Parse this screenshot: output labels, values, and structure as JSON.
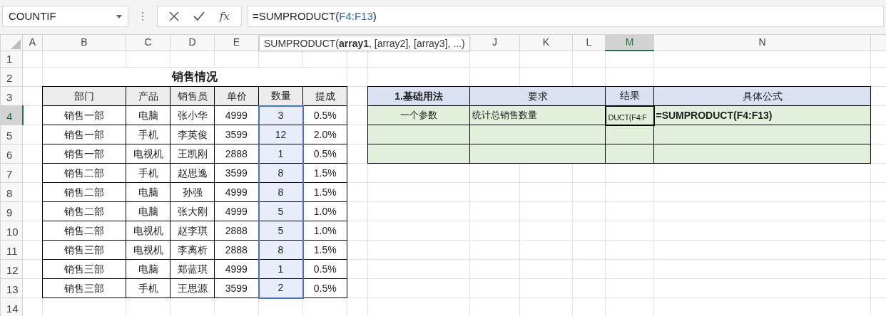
{
  "name_box": {
    "value": "COUNTIF"
  },
  "formula_bar": {
    "fx": "fx",
    "parts": [
      {
        "text": "=SUMPRODUCT(",
        "kind": "plain"
      },
      {
        "text": "F4:F13",
        "kind": "ref"
      },
      {
        "text": ")",
        "kind": "plain"
      }
    ]
  },
  "tooltip": "SUMPRODUCT(**array1**, [array2], [array3], ...)",
  "column_headers": [
    {
      "label": "A",
      "selected": false
    },
    {
      "label": "B",
      "selected": false
    },
    {
      "label": "C",
      "selected": false
    },
    {
      "label": "D",
      "selected": false
    },
    {
      "label": "E",
      "selected": false
    },
    {
      "label": "J",
      "selected": false
    },
    {
      "label": "K",
      "selected": false
    },
    {
      "label": "L",
      "selected": false
    },
    {
      "label": "M",
      "selected": true
    },
    {
      "label": "N",
      "selected": false
    }
  ],
  "row_headers": [
    {
      "label": "1",
      "selected": false
    },
    {
      "label": "2",
      "selected": false
    },
    {
      "label": "3",
      "selected": false
    },
    {
      "label": "4",
      "selected": true
    },
    {
      "label": "5",
      "selected": false
    },
    {
      "label": "6",
      "selected": false
    },
    {
      "label": "7",
      "selected": false
    },
    {
      "label": "8",
      "selected": false
    },
    {
      "label": "9",
      "selected": false
    },
    {
      "label": "10",
      "selected": false
    },
    {
      "label": "11",
      "selected": false
    },
    {
      "label": "12",
      "selected": false
    },
    {
      "label": "13",
      "selected": false
    },
    {
      "label": "14",
      "selected": false
    }
  ],
  "sales_table": {
    "title": "销售情况",
    "columns": [
      "部门",
      "产品",
      "销售员",
      "单价",
      "数量",
      "提成"
    ],
    "rows": [
      {
        "cells": [
          "销售一部",
          "电脑",
          "张小华",
          "4999",
          "3",
          "0.5%"
        ],
        "qty_selected": true
      },
      {
        "cells": [
          "销售一部",
          "手机",
          "李英俊",
          "3599",
          "12",
          "2.0%"
        ],
        "qty_selected": true
      },
      {
        "cells": [
          "销售一部",
          "电视机",
          "王凯刚",
          "2888",
          "1",
          "0.5%"
        ],
        "qty_selected": true
      },
      {
        "cells": [
          "销售二部",
          "手机",
          "赵思逸",
          "3599",
          "8",
          "1.5%"
        ],
        "qty_selected": true
      },
      {
        "cells": [
          "销售二部",
          "电脑",
          "孙强",
          "4999",
          "8",
          "1.5%"
        ],
        "qty_selected": true
      },
      {
        "cells": [
          "销售二部",
          "电脑",
          "张大刚",
          "4999",
          "5",
          "1.0%"
        ],
        "qty_selected": true
      },
      {
        "cells": [
          "销售二部",
          "电视机",
          "赵李琪",
          "2888",
          "5",
          "1.0%"
        ],
        "qty_selected": true
      },
      {
        "cells": [
          "销售三部",
          "电视机",
          "李离析",
          "2888",
          "8",
          "1.5%"
        ],
        "qty_selected": true
      },
      {
        "cells": [
          "销售三部",
          "电脑",
          "郑蓝琪",
          "4999",
          "1",
          "0.5%"
        ],
        "qty_selected": true
      },
      {
        "cells": [
          "销售三部",
          "手机",
          "王思源",
          "3599",
          "2",
          "0.5%"
        ],
        "qty_selected": true
      }
    ]
  },
  "usage_table": {
    "columns": [
      "1.基础用法",
      "要求",
      "结果",
      "具体公式"
    ],
    "rows": [
      {
        "kind": "filled",
        "cells": [
          "一个参数",
          "统计总销售数量",
          "DUCT(F4:F",
          "=SUMPRODUCT(F4:F13)"
        ],
        "result_selected": true
      },
      {
        "kind": "blank"
      },
      {
        "kind": "blank"
      }
    ]
  }
}
